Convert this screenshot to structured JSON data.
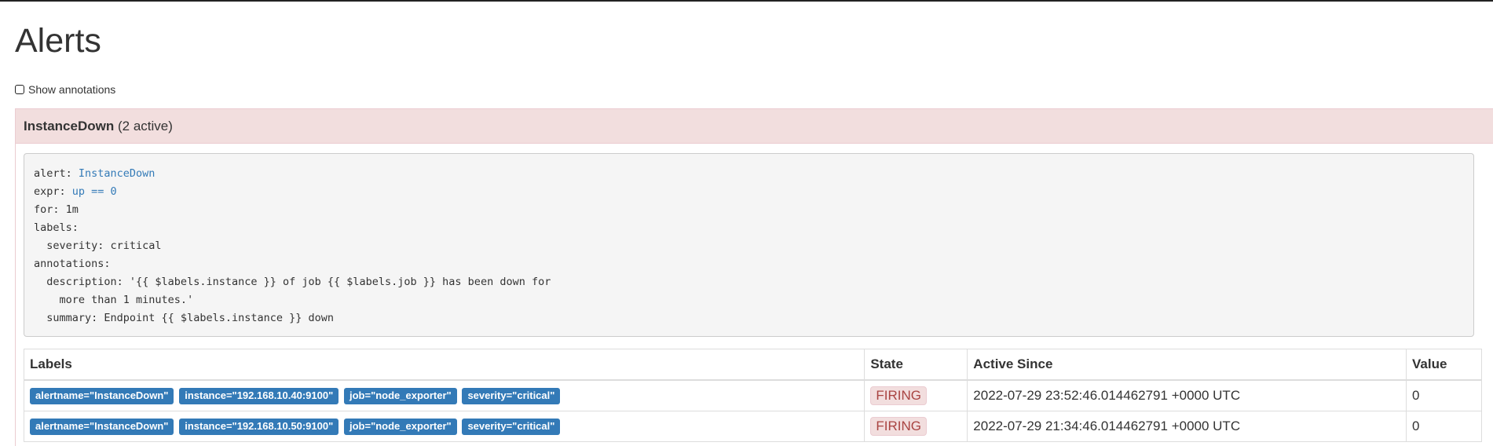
{
  "page": {
    "title": "Alerts"
  },
  "controls": {
    "show_annotations_label": "Show annotations"
  },
  "alert_group": {
    "name": "InstanceDown",
    "count_text": "(2 active)",
    "rule": {
      "line1_key": "alert: ",
      "line1_val": "InstanceDown",
      "line2_key": "expr: ",
      "line2_val": "up == 0",
      "line3": "for: 1m",
      "line4": "labels:",
      "line5": "  severity: critical",
      "line6": "annotations:",
      "line7": "  description: '{{ $labels.instance }} of job {{ $labels.job }} has been down for",
      "line8": "    more than 1 minutes.'",
      "line9": "  summary: Endpoint {{ $labels.instance }} down"
    },
    "table": {
      "headers": {
        "labels": "Labels",
        "state": "State",
        "active_since": "Active Since",
        "value": "Value"
      },
      "rows": [
        {
          "labels": [
            "alertname=\"InstanceDown\"",
            "instance=\"192.168.10.40:9100\"",
            "job=\"node_exporter\"",
            "severity=\"critical\""
          ],
          "state": "FIRING",
          "active_since": "2022-07-29 23:52:46.014462791 +0000 UTC",
          "value": "0"
        },
        {
          "labels": [
            "alertname=\"InstanceDown\"",
            "instance=\"192.168.10.50:9100\"",
            "job=\"node_exporter\"",
            "severity=\"critical\""
          ],
          "state": "FIRING",
          "active_since": "2022-07-29 21:34:46.014462791 +0000 UTC",
          "value": "0"
        }
      ]
    }
  },
  "colors": {
    "heading_bg": "#f2dede",
    "label_bg": "#337ab7",
    "firing_text": "#a94442"
  }
}
